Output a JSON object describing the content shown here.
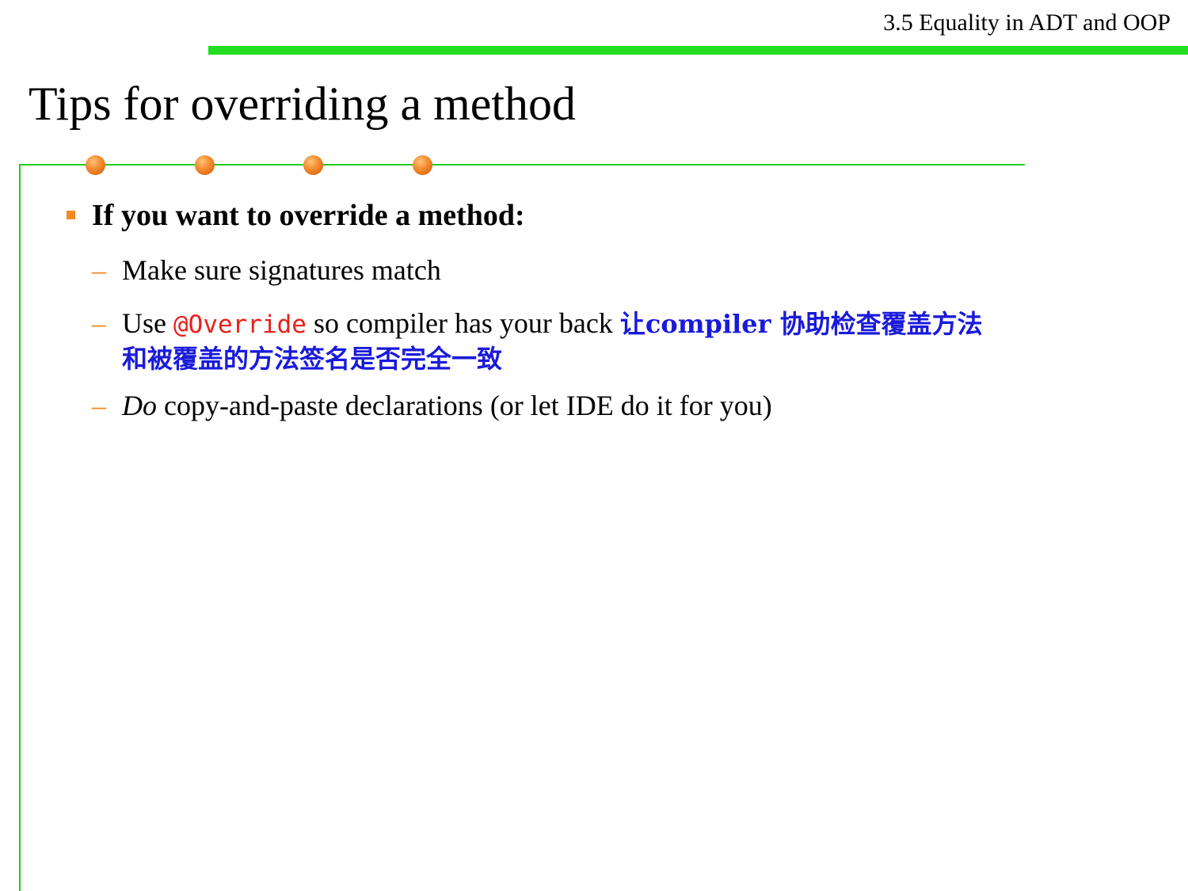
{
  "header": {
    "section": "3.5 Equality in ADT and OOP"
  },
  "slide": {
    "title": "Tips for overriding a method"
  },
  "content": {
    "main_bullet": "If you want to override a method:",
    "sub1": "Make sure signatures match",
    "sub2_prefix": "Use ",
    "sub2_code": "@Override",
    "sub2_suffix": " so compiler has your back ",
    "sub2_note_line1": "让compiler 协助检查覆盖方法",
    "sub2_note_line2": "和被覆盖的方法签名是否完全一致",
    "sub3_emphasis": "Do",
    "sub3_rest": " copy-and-paste declarations (or let IDE do it for you)",
    "dash": "–"
  },
  "colors": {
    "accent_green": "#22dd22",
    "bullet_orange": "#f4891f",
    "code_red": "#e8201a",
    "note_blue": "#1a1adb"
  }
}
